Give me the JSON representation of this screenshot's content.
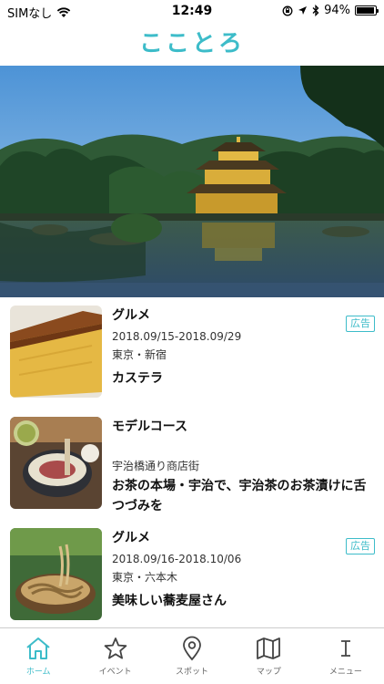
{
  "status": {
    "carrier": "SIMなし",
    "time": "12:49",
    "battery": "94%",
    "battery_level": 0.94
  },
  "header": {
    "title": "こことろ"
  },
  "feed": [
    {
      "category": "グルメ",
      "date": "2018.09/15-2018.09/29",
      "place": "東京・新宿",
      "title": "カステラ",
      "badge": "広告",
      "thumbnail": "castella-cake"
    },
    {
      "category": "モデルコース",
      "date": "",
      "place": "宇治橋通り商店街",
      "title": "お茶の本場・宇治で、宇治茶のお茶漬けに舌つづみを",
      "badge": "",
      "thumbnail": "ochazuke"
    },
    {
      "category": "グルメ",
      "date": "2018.09/16-2018.10/06",
      "place": "東京・六本木",
      "title": "美味しい蕎麦屋さん",
      "badge": "広告",
      "thumbnail": "soba"
    }
  ],
  "tabs": [
    {
      "label": "ホーム",
      "icon": "home-icon",
      "active": true
    },
    {
      "label": "イベント",
      "icon": "star-icon",
      "active": false
    },
    {
      "label": "スポット",
      "icon": "map-pin-icon",
      "active": false
    },
    {
      "label": "マップ",
      "icon": "map-icon",
      "active": false
    },
    {
      "label": "メニュー",
      "icon": "menu-icon",
      "active": false
    }
  ],
  "colors": {
    "accent": "#3dbcc9",
    "tab_inactive": "#666666"
  }
}
